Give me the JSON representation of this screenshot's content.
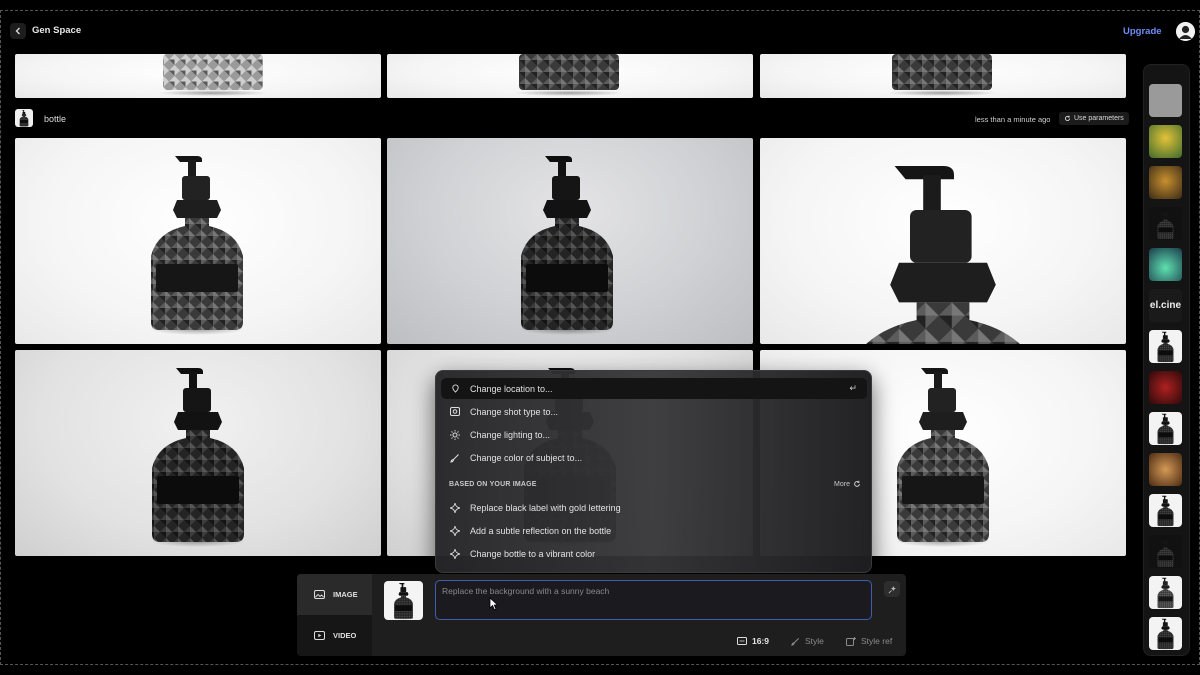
{
  "header": {
    "title": "Gen Space",
    "upgrade_label": "Upgrade"
  },
  "group": {
    "label": "bottle",
    "time": "less than a minute ago",
    "use_parameters_label": "Use parameters"
  },
  "dropdown": {
    "items": [
      {
        "label": "Change location to...",
        "icon": "pin-icon"
      },
      {
        "label": "Change shot type to...",
        "icon": "image-icon"
      },
      {
        "label": "Change lighting to...",
        "icon": "sun-icon"
      },
      {
        "label": "Change color of subject to...",
        "icon": "brush-icon"
      }
    ],
    "enter_glyph": "↵",
    "section_label": "BASED ON YOUR IMAGE",
    "more_label": "More",
    "suggestions": [
      {
        "label": "Replace black label with gold lettering",
        "icon": "sparkle-icon"
      },
      {
        "label": "Add a subtle reflection on the bottle",
        "icon": "sparkle-icon"
      },
      {
        "label": "Change bottle to a vibrant color",
        "icon": "sparkle-icon"
      }
    ]
  },
  "composer": {
    "modes": [
      {
        "label": "IMAGE",
        "icon": "image-icon"
      },
      {
        "label": "VIDEO",
        "icon": "play-icon"
      }
    ],
    "prompt_placeholder": "Replace the background with a sunny beach",
    "aspect_ratio": "16:9",
    "style_label": "Style",
    "style_ref_label": "Style ref"
  },
  "rail": {
    "thumb_text": "el.cine"
  },
  "colors": {
    "accent": "#6f8df5",
    "background": "#000000",
    "prompt_border": "#3f5fae"
  }
}
